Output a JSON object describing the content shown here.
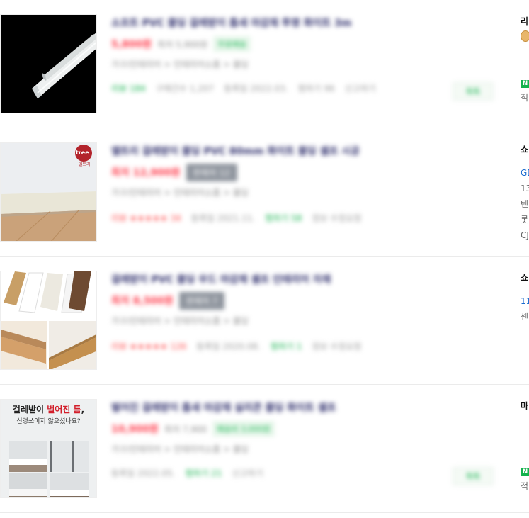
{
  "products": [
    {
      "title": "소프트 PVC 몰딩 걸레받이 틈새 마감재 투명 화이트 3m",
      "price": "5,800원",
      "price_sub": "최저 5,900원",
      "tag": "무료배송",
      "tag_type": "green",
      "category": "가구/인테리어 > 인테리어소품 > 몰딩",
      "meta": [
        "리뷰 184",
        "구매건수 1,207",
        "등록일 2022.03.",
        "찜하기 96",
        "신고하기"
      ],
      "meta_colors": [
        "g",
        "g",
        "",
        "g",
        ""
      ],
      "side_button": "톡톡",
      "mall": {
        "name": "리",
        "lines": [
          "적"
        ],
        "badge": "N",
        "medal": true
      }
    },
    {
      "title": "엘트리 걸레받이 몰딩 PVC 80mm 화이트 몰딩 셀프 시공",
      "price": "최저 12,900원",
      "price_sub": "",
      "tag": "판매처 12",
      "tag_type": "grey",
      "category": "가구/인테리어 > 인테리어소품 > 몰딩",
      "meta": [
        "리뷰 ★★★★★ 34",
        "등록일 2021.11.",
        "찜하기 58",
        "정보 수정요청"
      ],
      "meta_colors": [
        "r",
        "",
        "g",
        ""
      ],
      "side_button": "",
      "image_text": "tree",
      "image_sub": "엘트리",
      "mall": {
        "name": "쇼",
        "lines": [
          "GD",
          "13",
          "텐",
          "롯",
          "CJ"
        ]
      }
    },
    {
      "title": "걸레받이 PVC 몰딩 우드 마감재 셀프 인테리어 자재",
      "price": "최저 8,500원",
      "price_sub": "",
      "tag": "판매처 7",
      "tag_type": "grey",
      "category": "가구/인테리어 > 인테리어소품 > 몰딩",
      "meta": [
        "리뷰 ★★★★★ 126",
        "등록일 2020.08.",
        "찜하기 1",
        "정보 수정요청"
      ],
      "meta_colors": [
        "r",
        "",
        "g",
        ""
      ],
      "side_button": "",
      "mall": {
        "name": "쇼",
        "lines": [
          "11",
          "센"
        ]
      }
    },
    {
      "title": "벌어진 걸레받이 틈새 마감재 실리콘 몰딩 화이트 셀프",
      "price": "10,900원",
      "price_sub": "최저 7,900",
      "tag": "배송비 3,000원",
      "tag_type": "green",
      "category": "가구/인테리어 > 인테리어소품 > 몰딩",
      "meta": [
        "등록일 2022.05.",
        "찜하기 21",
        "신고하기"
      ],
      "meta_colors": [
        "",
        "g",
        ""
      ],
      "side_button": "톡톡",
      "image_headline": {
        "part1": "걸레받이 ",
        "part2": "벌어진 틈",
        "part3": ",",
        "line2": "신경쓰이지 않으셨나요?"
      },
      "mall": {
        "name": "마",
        "lines": [
          "적"
        ],
        "badge": "N"
      }
    }
  ],
  "colors": {
    "accent_green": "#14b24d",
    "price_red": "#ff3b4b",
    "link_blue": "#1a6bcf"
  }
}
